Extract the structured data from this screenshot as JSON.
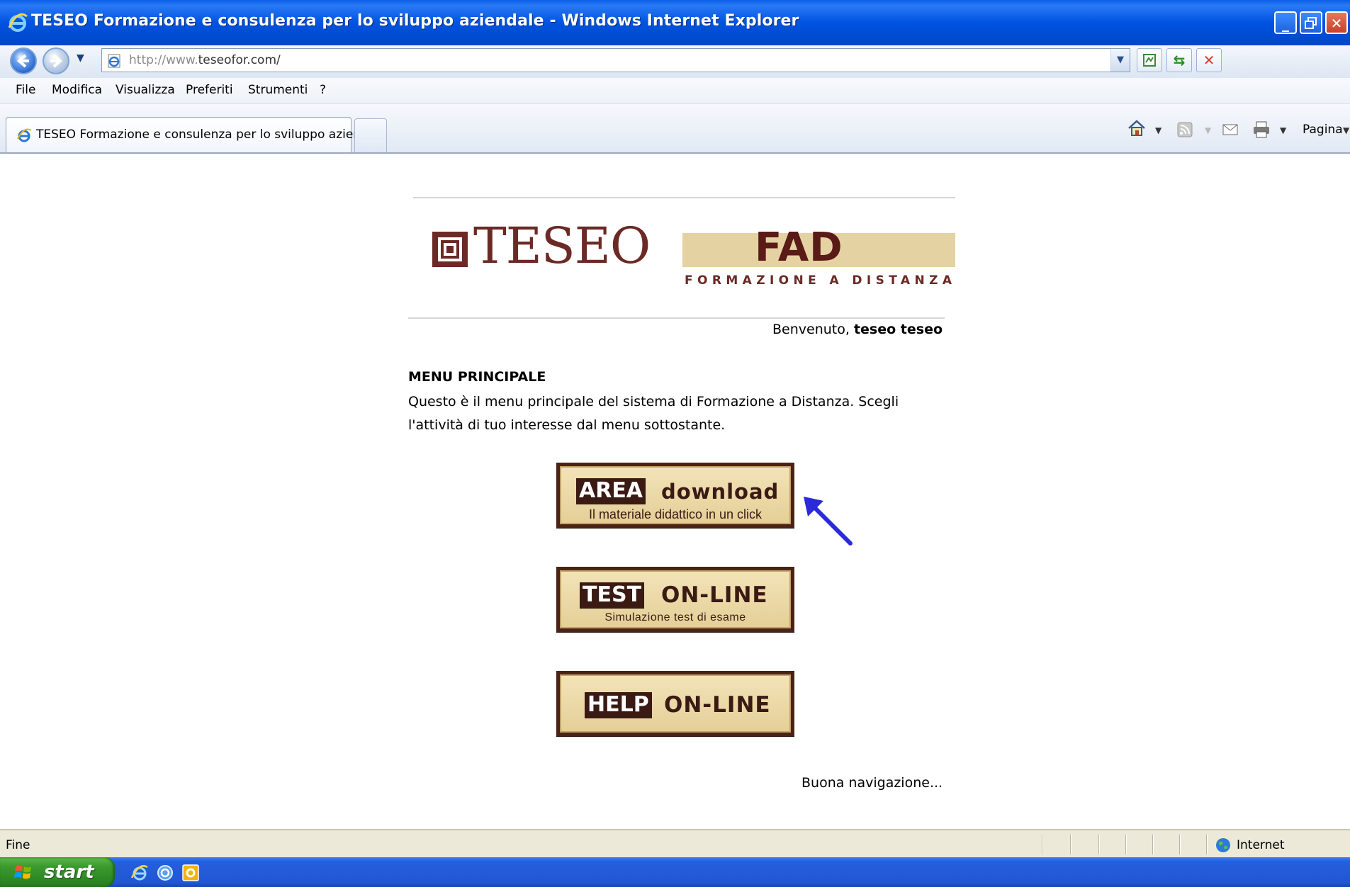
{
  "window": {
    "title": "TESEO Formazione e consulenza per lo sviluppo aziendale - Windows Internet Explorer",
    "controls": [
      "minimize",
      "restore",
      "close"
    ]
  },
  "address_bar": {
    "url_prefix": "http://www.",
    "url_main": "teseofor.com/"
  },
  "menu": [
    "File",
    "Modifica",
    "Visualizza",
    "Preferiti",
    "Strumenti",
    "?"
  ],
  "tabs": {
    "active_label": "TESEO Formazione e consulenza per lo sviluppo azien..."
  },
  "command_bar": {
    "page_label": "Pagina"
  },
  "page": {
    "logo_text": "TESEO",
    "fad_text": "FAD",
    "fad_subtitle": "FORMAZIONE A DISTANZA",
    "welcome_prefix": "Benvenuto,",
    "welcome_user": "teseo teseo",
    "menu_title": "MENU PRINCIPALE",
    "menu_description": "Questo è il menu principale del sistema di Formazione a Distanza. Scegli l'attività di tuo interesse dal menu sottostante.",
    "buttons": [
      {
        "tag": "AREA",
        "word": "download",
        "caption": "Il materiale didattico in un click"
      },
      {
        "tag": "TEST",
        "word": "ON-LINE",
        "caption": "Simulazione test di esame"
      },
      {
        "tag": "HELP",
        "word": "ON-LINE",
        "caption": ""
      }
    ],
    "closing": "Buona navigazione..."
  },
  "status_bar": {
    "status": "Fine",
    "zone": "Internet"
  },
  "taskbar": {
    "start_label": "start"
  },
  "colors": {
    "title_bar": "#0053e0",
    "brand_maroon": "#6b2a25",
    "fad_beige": "#e5d2a2",
    "button_face": "#e5cf97",
    "arrow": "#2a2ad6",
    "start_green": "#3c9a2e"
  }
}
